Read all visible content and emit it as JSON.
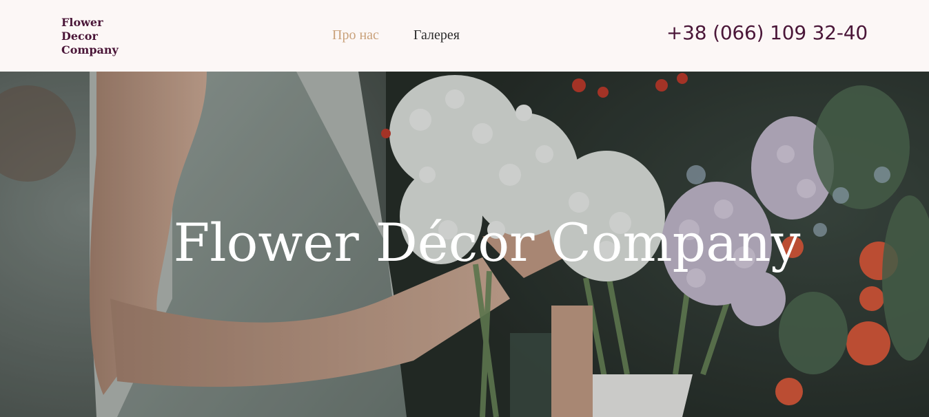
{
  "header": {
    "logo_lines": [
      "Flower",
      "Decor",
      "Company"
    ],
    "nav": [
      {
        "label": "Про нас",
        "active": true
      },
      {
        "label": "Галерея",
        "active": false
      }
    ],
    "phone": "+38 (066) 109 32-40"
  },
  "hero": {
    "title": "Flower Décor Company",
    "image": "florist-with-flowers-photo"
  },
  "colors": {
    "brand": "#4a1638",
    "nav_active": "#c9a17a",
    "header_bg": "#fcf7f6"
  }
}
